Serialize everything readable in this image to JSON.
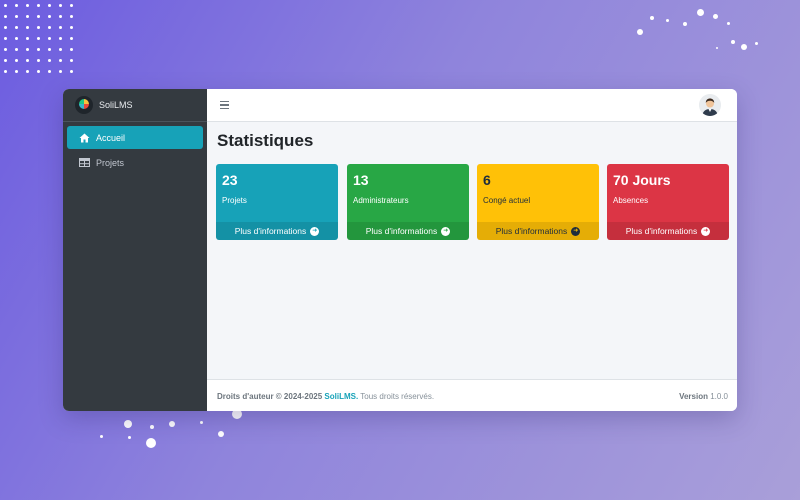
{
  "colors": {
    "sidebar_bg": "#343a40",
    "accent": "#17a2b8",
    "card_info": "#17a2b8",
    "card_success": "#28a745",
    "card_warning": "#ffc107",
    "card_danger": "#dc3545"
  },
  "app": {
    "name": "SoliLMS"
  },
  "sidebar": {
    "items": [
      {
        "label": "Accueil",
        "icon": "home-icon",
        "active": true
      },
      {
        "label": "Projets",
        "icon": "table-icon",
        "active": false
      }
    ]
  },
  "topbar": {
    "menu_icon": "hamburger-icon",
    "avatar_icon": "user-avatar-icon"
  },
  "main": {
    "title": "Statistiques"
  },
  "cards": [
    {
      "value": "23",
      "label": "Projets",
      "link": "Plus d'informations",
      "color": "#17a2b8"
    },
    {
      "value": "13",
      "label": "Administrateurs",
      "link": "Plus d'informations",
      "color": "#28a745"
    },
    {
      "value": "6",
      "label": "Congé actuel",
      "link": "Plus d'informations",
      "color": "#ffc107"
    },
    {
      "value": "70 Jours",
      "label": "Absences",
      "link": "Plus d'informations",
      "color": "#dc3545"
    }
  ],
  "footer": {
    "copyright_prefix": "Droits d'auteur © 2024-2025",
    "brand": "SoliLMS.",
    "rights": "Tous droits réservés.",
    "version_label": "Version",
    "version_value": "1.0.0"
  }
}
